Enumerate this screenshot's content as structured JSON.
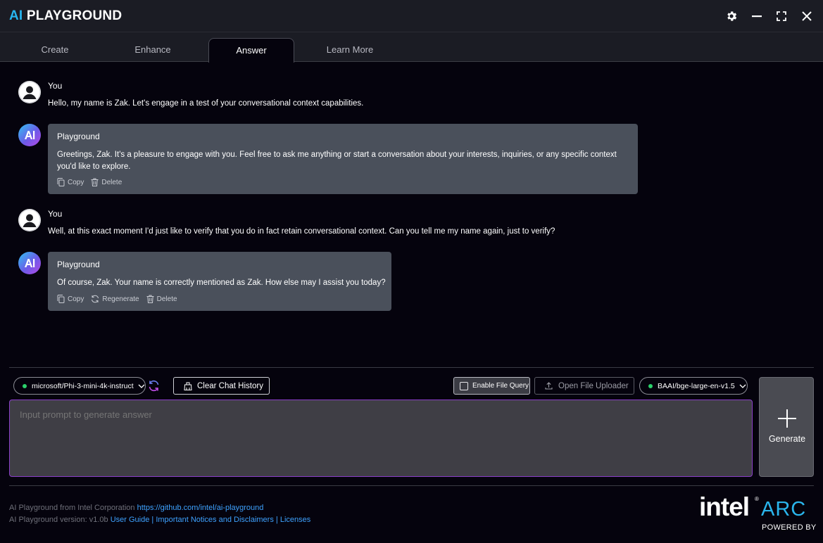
{
  "app": {
    "title_ai": "AI",
    "title_rest": "PLAYGROUND"
  },
  "tabs": [
    {
      "label": "Create",
      "active": false
    },
    {
      "label": "Enhance",
      "active": false
    },
    {
      "label": "Answer",
      "active": true
    },
    {
      "label": "Learn More",
      "active": false
    }
  ],
  "messages": [
    {
      "role": "user",
      "name": "You",
      "text": "Hello, my name is Zak. Let's engage in a test of your conversational context capabilities."
    },
    {
      "role": "assistant",
      "name": "Playground",
      "text": "Greetings, Zak. It's a pleasure to engage with you. Feel free to ask me anything or start a conversation about your interests, inquiries, or any specific context you'd like to explore.",
      "actions": [
        "Copy",
        "Delete"
      ]
    },
    {
      "role": "user",
      "name": "You",
      "text": "Well, at this exact moment I'd just like to verify that you do in fact retain conversational context. Can you tell me my name again, just to verify?"
    },
    {
      "role": "assistant",
      "name": "Playground",
      "text": "Of course, Zak. Your name is correctly mentioned as Zak. How else may I assist you today?",
      "actions": [
        "Copy",
        "Regenerate",
        "Delete"
      ]
    }
  ],
  "controls": {
    "llm_model": "microsoft/Phi-3-mini-4k-instruct",
    "clear_chat": "Clear Chat History",
    "enable_file_query": "Enable File Query",
    "open_file_uploader": "Open File Uploader",
    "embedding_model": "BAAI/bge-large-en-v1.5",
    "prompt_placeholder": "Input prompt to generate answer",
    "generate": "Generate"
  },
  "footer": {
    "line1_text": "AI Playground from Intel Corporation",
    "line1_link": "https://github.com/intel/ai-playground",
    "line2_text": "AI Playground version: v1.0b",
    "user_guide": "User Guide",
    "notices": "Important Notices and Disclaimers",
    "licenses": "Licenses",
    "separator": "|"
  },
  "brand": {
    "intel": "intel",
    "arc": "ARC",
    "tm": "®",
    "powered_by": "POWERED BY"
  },
  "colors": {
    "accent_blue": "#27b6f0",
    "prompt_border": "#8a3fc8",
    "status_green": "#2bd16b",
    "link": "#3ea2ff"
  }
}
